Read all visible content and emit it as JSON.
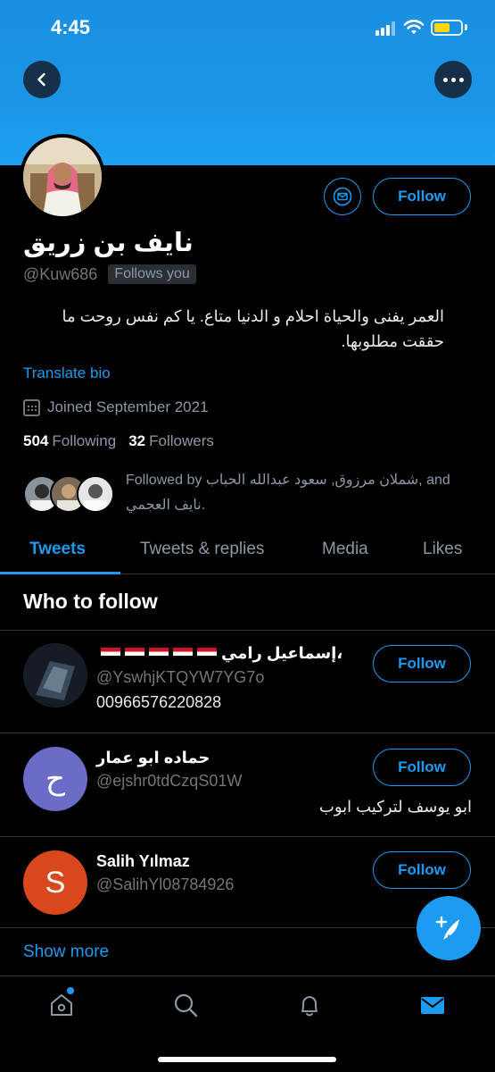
{
  "status_bar": {
    "time": "4:45"
  },
  "profile": {
    "name": "نايف بن زريق",
    "handle": "@Kuw686",
    "follows_you": "Follows you",
    "follow_label": "Follow",
    "bio": "العمر يفنى والحياة احلام و الدنيا متاع. يا كم نفس روحت ما حققت مطلوبها.",
    "translate_bio": "Translate bio",
    "joined": "Joined September 2021",
    "following_count": "504",
    "following_label": "Following",
    "followers_count": "32",
    "followers_label": "Followers",
    "followed_by": "Followed by شملان مرزوق, سعود عبدالله الحباب, and نايف العجمي."
  },
  "tabs": [
    {
      "label": "Tweets",
      "active": true
    },
    {
      "label": "Tweets & replies",
      "active": false
    },
    {
      "label": "Media",
      "active": false
    },
    {
      "label": "Likes",
      "active": false
    }
  ],
  "who_to_follow": {
    "title": "Who to follow",
    "suggestions": [
      {
        "name": "إسماعيل رامي،",
        "handle": "@YswhjKTQYW7YG7o",
        "bio": "00966576220828",
        "follow_label": "Follow",
        "avatar": "photo",
        "flags": 5
      },
      {
        "name": "حماده ابو عمار",
        "handle": "@ejshr0tdCzqS01W",
        "bio": "ابو يوسف لتركيب ابوب",
        "follow_label": "Follow",
        "avatar_letter": "ح",
        "avatar_color": "#6b6bc8"
      },
      {
        "name": "Salih Yılmaz",
        "handle": "@SalihYl08784926",
        "bio": "",
        "follow_label": "Follow",
        "avatar_letter": "S",
        "avatar_color": "#d9481c"
      }
    ],
    "show_more": "Show more"
  },
  "colors": {
    "accent": "#1d9bf0",
    "background": "#000000",
    "banner": "#1b95e6"
  },
  "icons": [
    "back-arrow-icon",
    "more-dots-icon",
    "mail-icon",
    "calendar-icon",
    "compose-tweet-icon",
    "home-icon",
    "search-icon",
    "bell-icon",
    "envelope-icon"
  ]
}
